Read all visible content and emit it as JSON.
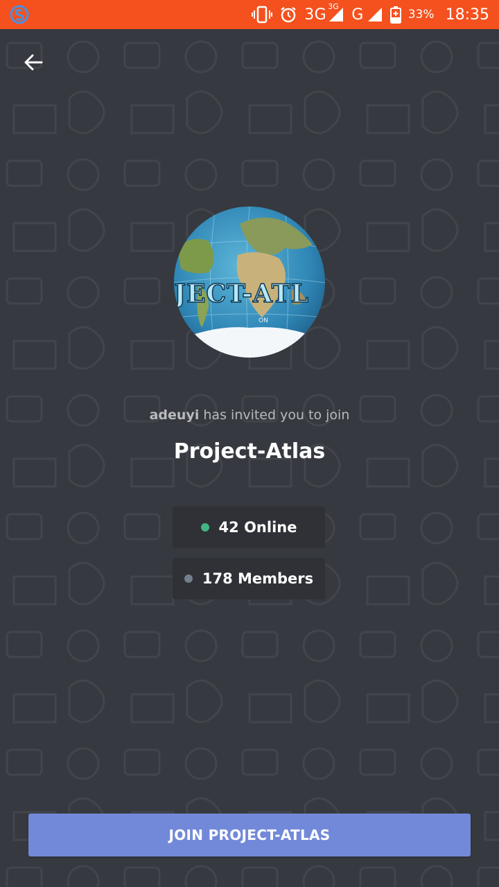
{
  "status_bar": {
    "network_3g": "3G",
    "network_3g_small": "3G",
    "network_g": "G",
    "battery": "33%",
    "time": "18:35",
    "bar_color": "#f4511e"
  },
  "header": {
    "back_icon": "arrow-left-icon"
  },
  "invite": {
    "inviter": "adeuyi",
    "message": " has invited you to join",
    "server_name": "Project-Atlas",
    "online": "42 Online",
    "members": "178 Members",
    "online_color": "#43b581",
    "offline_color": "#747f8d"
  },
  "join_button": {
    "label": "JOIN PROJECT-ATLAS",
    "color": "#7289da"
  }
}
